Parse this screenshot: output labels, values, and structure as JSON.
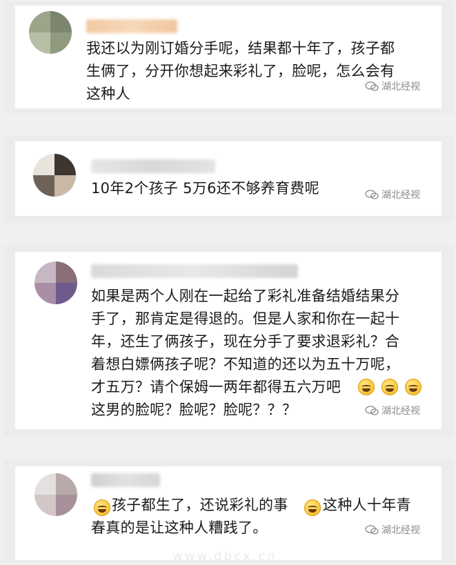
{
  "watermark": "湖北经视",
  "bottom_watermark": "www.dbcx.cn",
  "comments": [
    {
      "text": "我还以为刚订婚分手呢，结果都十年了，孩子都\n生俩了，分开你想起来彩礼了，脸呢，怎么会有\n这种人"
    },
    {
      "text": "10年2个孩子 5万6还不够养育费呢"
    },
    {
      "text_1": "如果是两个人刚在一起给了彩礼准备结婚结果分\n手了，那肯定是得退的。但是人家和你在一起十\n年，还生了俩孩子，现在分手了要求退彩礼？合\n着想白嫖俩孩子呢？不知道的还以为五十万呢，\n才五万？请个保姆一两年都得五六万吧",
      "text_2": "这男的脸呢？脸呢？脸呢？？？"
    },
    {
      "text_1": "孩子都生了，还说彩礼的事",
      "text_2": "这种人十年青",
      "text_3": "春真的是让这种人糟践了。"
    }
  ]
}
